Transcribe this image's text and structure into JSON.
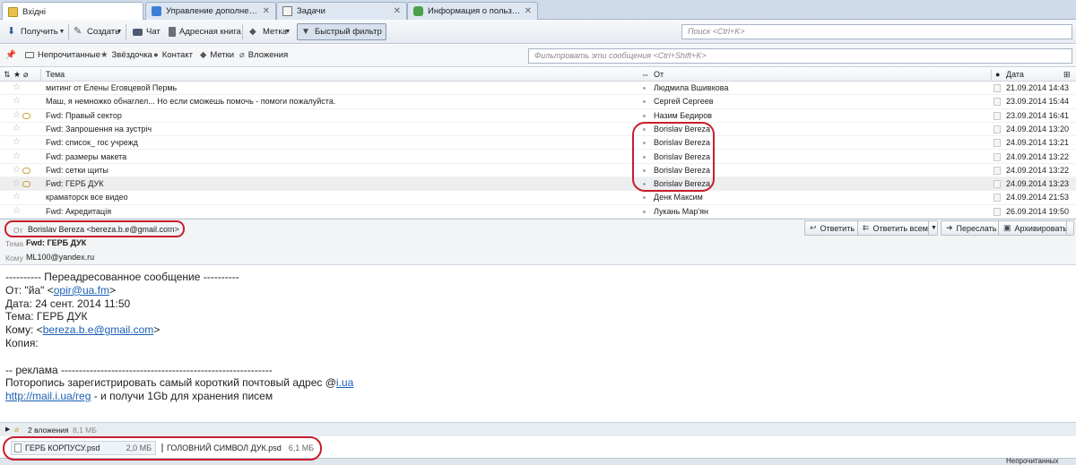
{
  "tabs": [
    {
      "label": "Вхідні",
      "icon": "inbox-folder-icon"
    },
    {
      "label": "Управление дополнения…",
      "icon": "addons-puzzle-icon"
    },
    {
      "label": "Задачи",
      "icon": "tasks-icon"
    },
    {
      "label": "Информация о пользова…",
      "icon": "puzzle-icon"
    }
  ],
  "toolbar": {
    "get_label": "Получить",
    "create_label": "Создать",
    "chat_label": "Чат",
    "addressbook_label": "Адресная книга",
    "tag_label": "Метка",
    "quickfilter_label": "Быстрый фильтр",
    "search_placeholder": "Поиск <Ctrl+K>"
  },
  "filterbar": {
    "unread": "Непрочитанные",
    "starred": "Звёздочка",
    "contact": "Контакт",
    "tags": "Метки",
    "attachments": "Вложения",
    "filter_placeholder": "Фильтровать эти сообщения <Ctrl+Shift+K>"
  },
  "columns": {
    "subject": "Тема",
    "from": "От",
    "date": "Дата"
  },
  "messages": [
    {
      "subject": "митинг от Елены Еговцевой Пермь",
      "from": "Людмила Вшивкова",
      "date": "21.09.2014 14:43",
      "attach": false
    },
    {
      "subject": "Маш, я немножко обнаглел... Но если сможешь помочь - помоги пожалуйста.",
      "from": "Сергей Сергеев",
      "date": "23.09.2014 15:44",
      "attach": false
    },
    {
      "subject": "Fwd: Правый сектор",
      "from": "Назим Бедиров",
      "date": "23.09.2014 16:41",
      "attach": true
    },
    {
      "subject": "Fwd: Запрошення на зустріч",
      "from": "Borislav Bereza",
      "date": "24.09.2014 13:20",
      "attach": false
    },
    {
      "subject": "Fwd: список_ гос учрежд",
      "from": "Borislav Bereza",
      "date": "24.09.2014 13:21",
      "attach": false
    },
    {
      "subject": "Fwd: размеры макета",
      "from": "Borislav Bereza",
      "date": "24.09.2014 13:22",
      "attach": false
    },
    {
      "subject": "Fwd: сетки щиты",
      "from": "Borislav Bereza",
      "date": "24.09.2014 13:22",
      "attach": true
    },
    {
      "subject": "Fwd: ГЕРБ ДУК",
      "from": "Borislav Bereza",
      "date": "24.09.2014 13:23",
      "attach": true,
      "selected": true
    },
    {
      "subject": "краматорск все видео",
      "from": "Денк Максим",
      "date": "24.09.2014 21:53",
      "attach": false
    },
    {
      "subject": "Fwd: Акредитація",
      "from": "Лукань Мар'ян",
      "date": "26.09.2014 19:50",
      "attach": false
    }
  ],
  "header": {
    "from_label": "От",
    "from_value": "Borislav Bereza <bereza.b.e@gmail.com>",
    "subject_label": "Тема",
    "subject_value": "Fwd: ГЕРБ ДУК",
    "to_label": "Кому",
    "to_value": "ML100@yandex.ru",
    "reply": "Ответить",
    "reply_all": "Ответить всем",
    "forward": "Переслать",
    "archive": "Архивировать"
  },
  "body": {
    "fwd_line": "---------- Переадресованное сообщение ----------",
    "from_prefix": "От: \"йа\" <",
    "from_email": "opir@ua.fm",
    "from_suffix": ">",
    "date_line": "Дата: 24 сент. 2014 11:50",
    "subject_line": "Тема: ГЕРБ ДУК",
    "to_prefix": "Кому: <",
    "to_email": "bereza.b.e@gmail.com",
    "to_suffix": ">",
    "copy_line": "Копия:",
    "ad_line": "-- реклама -----------------------------------------------------------",
    "promo_text": "Потoропись зарегистрировать самый короткий почтовый адрес @",
    "promo_link": "i.ua",
    "reg_link": "http://mail.i.ua/reg",
    "reg_suffix": " - и получи 1Gb для хранения писем"
  },
  "attachments": {
    "summary": "2 вложения",
    "total_size": "8,1 МБ",
    "items": [
      {
        "name": "ГЕРБ КОРПУСУ.psd",
        "size": "2,0 МБ"
      },
      {
        "name": "ГОЛОВНИЙ СИМВОЛ ДУК.psd",
        "size": "6,1 МБ"
      }
    ]
  },
  "status": {
    "unread": "Непрочитанных"
  },
  "colors": {
    "annotation_red": "#c81e2b",
    "link_blue": "#1a5fb4",
    "attach_gold": "#c8a13c"
  }
}
